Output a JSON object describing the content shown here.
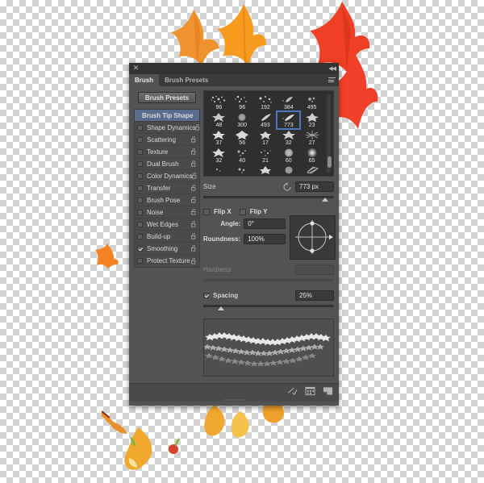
{
  "canvas": {
    "background": "transparent-checkerboard",
    "checker_colors": [
      "#ffffff",
      "#d3d3d3"
    ],
    "decoration": "autumn-maple-leaves"
  },
  "panel": {
    "title_bar": {
      "close_label": "✕",
      "collapse_label": "◀◀"
    },
    "tabs": [
      {
        "label": "Brush",
        "active": true
      },
      {
        "label": "Brush Presets",
        "active": false
      }
    ],
    "menu_icon": "panel-menu-icon",
    "presets_button": "Brush Presets",
    "options": [
      {
        "label": "Brush Tip Shape",
        "type": "header",
        "selected": true,
        "checked": false,
        "lock": false
      },
      {
        "label": "Shape Dynamics",
        "type": "option",
        "checked": false,
        "lock": true
      },
      {
        "label": "Scattering",
        "type": "option",
        "checked": false,
        "lock": true
      },
      {
        "label": "Texture",
        "type": "option",
        "checked": false,
        "lock": true
      },
      {
        "label": "Dual Brush",
        "type": "option",
        "checked": false,
        "lock": true
      },
      {
        "label": "Color Dynamics",
        "type": "option",
        "checked": false,
        "lock": true
      },
      {
        "label": "Transfer",
        "type": "option",
        "checked": false,
        "lock": true
      },
      {
        "label": "Brush Pose",
        "type": "option",
        "checked": false,
        "lock": true
      },
      {
        "label": "Noise",
        "type": "option",
        "checked": false,
        "lock": true
      },
      {
        "label": "Wet Edges",
        "type": "option",
        "checked": false,
        "lock": true
      },
      {
        "label": "Build-up",
        "type": "option",
        "checked": false,
        "lock": true
      },
      {
        "label": "Smoothing",
        "type": "option",
        "checked": true,
        "lock": true
      },
      {
        "label": "Protect Texture",
        "type": "option",
        "checked": false,
        "lock": true
      }
    ],
    "brush_grid": {
      "selected_value": "773",
      "rows": [
        [
          "96",
          "96",
          "192",
          "384",
          "495"
        ],
        [
          "48",
          "300",
          "493",
          "773",
          "23"
        ],
        [
          "37",
          "56",
          "17",
          "32",
          "27"
        ],
        [
          "32",
          "40",
          "21",
          "60",
          "65"
        ]
      ],
      "scrollbar": "brush-grid-scrollbar"
    },
    "size": {
      "label": "Size",
      "value": "773 px",
      "reset_icon": "reset-arrow-icon",
      "slider_percent": 93
    },
    "flip": {
      "flip_x_label": "Flip X",
      "flip_x_checked": false,
      "flip_y_label": "Flip Y",
      "flip_y_checked": false
    },
    "angle": {
      "label": "Angle:",
      "value": "0°"
    },
    "roundness": {
      "label": "Roundness:",
      "value": "100%"
    },
    "hardness": {
      "label": "Hardness",
      "value": "",
      "enabled": false,
      "slider_percent": 0
    },
    "spacing": {
      "label": "Spacing",
      "checked": true,
      "value": "25%",
      "slider_percent": 12
    },
    "preview": "brush-stroke-preview",
    "footer_icons": [
      "toggle-brush-stroke-icon",
      "brush-presets-grid-icon",
      "new-brush-icon"
    ]
  }
}
